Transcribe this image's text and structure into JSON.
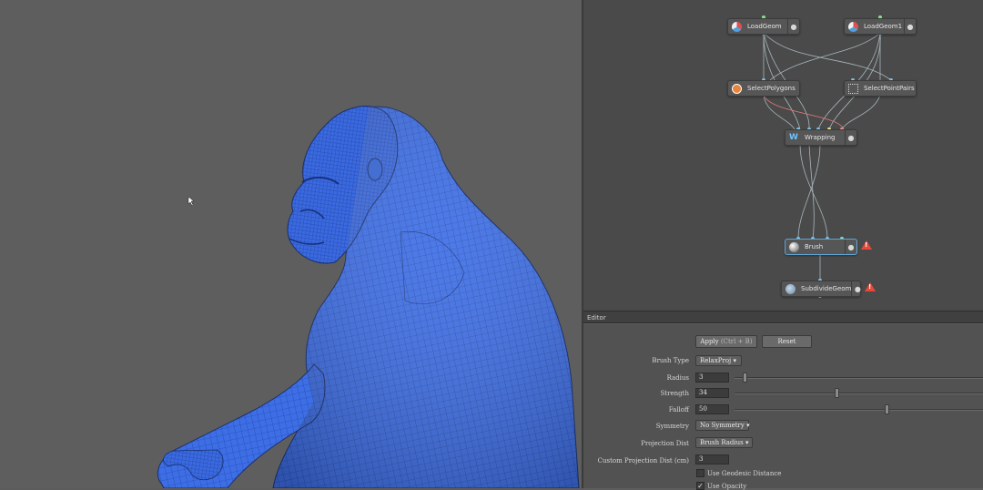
{
  "graph": {
    "nodes": [
      {
        "id": "loadgeom",
        "label": "LoadGeom",
        "icon": "load-geom-icon"
      },
      {
        "id": "loadgeom1",
        "label": "LoadGeom1",
        "icon": "load-geom-icon"
      },
      {
        "id": "selectpolygons",
        "label": "SelectPolygons",
        "icon": "select-polygons-icon"
      },
      {
        "id": "selectpointpairs",
        "label": "SelectPointPairs",
        "icon": "select-point-pairs-icon"
      },
      {
        "id": "wrapping",
        "label": "Wrapping",
        "icon": "wrapping-icon"
      },
      {
        "id": "brush",
        "label": "Brush",
        "icon": "brush-icon"
      },
      {
        "id": "subdividegeom",
        "label": "SubdivideGeom",
        "icon": "subdivide-icon"
      }
    ],
    "warning_glyph": "!"
  },
  "editor": {
    "title": "Editor",
    "apply_label": "Apply",
    "apply_shortcut": "Ctrl + B",
    "reset_label": "Reset",
    "params": {
      "brush_type": {
        "label": "Brush Type",
        "value": "RelaxProj"
      },
      "radius": {
        "label": "Radius",
        "value": "3",
        "level": 0.04
      },
      "strength": {
        "label": "Strength",
        "value": "34",
        "level": 0.41
      },
      "falloff": {
        "label": "Falloff",
        "value": "50",
        "level": 0.61
      },
      "symmetry": {
        "label": "Symmetry",
        "value": "No Symmetry"
      },
      "projection_dist": {
        "label": "Projection Dist",
        "value": "Brush Radius"
      },
      "custom_projection_dist": {
        "label": "Custom Projection Dist (cm)",
        "value": "3"
      },
      "use_geodesic": {
        "label": "Use Geodesic Distance",
        "checked": false
      },
      "use_opacity": {
        "label": "Use Opacity",
        "checked": true
      }
    }
  },
  "colors": {
    "mesh_blue": "#3d6ee6",
    "viewport_bg": "#5e5e5e",
    "graph_bg": "#4a4a4a",
    "selection": "#5fa8d8",
    "warning": "#e84a3a"
  }
}
